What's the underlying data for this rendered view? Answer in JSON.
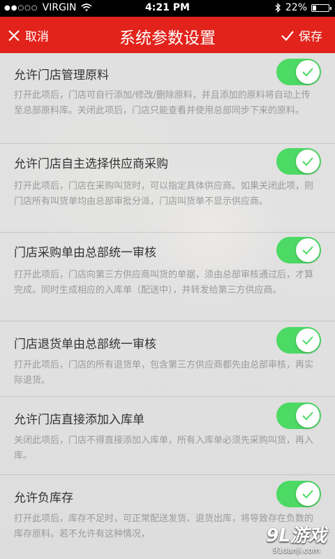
{
  "status_bar": {
    "carrier": "VIRGIN",
    "time": "4:21 PM",
    "battery": "22%",
    "battery_level": 0.22,
    "icons": [
      "signal-dots-icon",
      "wifi-icon",
      "bluetooth-icon",
      "battery-icon"
    ]
  },
  "nav": {
    "cancel_label": "取消",
    "title": "系统参数设置",
    "save_label": "保存",
    "bar_color": "#e2231b"
  },
  "settings": [
    {
      "title": "允许门店管理原料",
      "desc": "打开此项后，门店可自行添加/修改/删除原料，并且添加的原料将自动上传至总部原料库。关闭此项后，门店只能查看并使用总部同步下来的原料。",
      "enabled": true
    },
    {
      "title": "允许门店自主选择供应商采购",
      "desc": "打开此项后，门店在采购叫货时，可以指定具体供应商。如果关闭此项，则门店所有叫货单均由总部审批分派，门店叫货单不显示供应商。",
      "enabled": true
    },
    {
      "title": "门店采购单由总部统一审核",
      "desc": "打开此项后，门店向第三方供应商叫货的单据，须由总部审核通过后，才算完成。同时生成相应的入库单（配送中），并转发给第三方供应商。",
      "enabled": true
    },
    {
      "title": "门店退货单由总部统一审核",
      "desc": "打开此项后，门店的所有退货单，包含第三方供应商都先由总部审核，再实际退货。",
      "enabled": true
    },
    {
      "title": "允许门店直接添加入库单",
      "desc": "关闭此项后，门店不得直接添加入库单，所有入库单必须先采购叫货，再入库。",
      "enabled": true
    },
    {
      "title": "允许负库存",
      "desc": "打开此项后，库存不足时，可正常配送发货、退货出库，将导致存在负数的库存原料。若不允许有这种情况，",
      "enabled": true
    }
  ],
  "watermark": {
    "brand": "9L游戏",
    "domain": "91danji.com"
  },
  "colors": {
    "toggle_on": "#4cd964"
  }
}
